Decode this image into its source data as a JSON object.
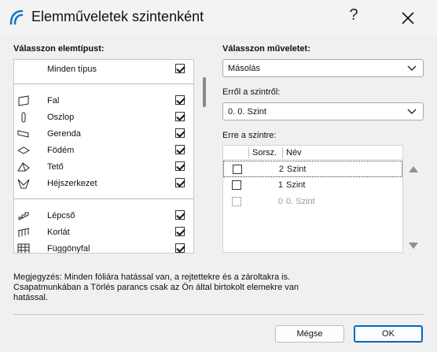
{
  "window": {
    "title": "Elemműveletek szintenként",
    "help_label": "?",
    "accent_color": "#1a73c8"
  },
  "element_types": {
    "label": "Válasszon elemtípust:",
    "all_label": "Minden típus",
    "all_checked": true,
    "groups": [
      [
        {
          "label": "Fal",
          "icon": "wall-icon",
          "checked": true
        },
        {
          "label": "Oszlop",
          "icon": "column-icon",
          "checked": true
        },
        {
          "label": "Gerenda",
          "icon": "beam-icon",
          "checked": true
        },
        {
          "label": "Födém",
          "icon": "slab-icon",
          "checked": true
        },
        {
          "label": "Tető",
          "icon": "roof-icon",
          "checked": true
        },
        {
          "label": "Héjszerkezet",
          "icon": "shell-icon",
          "checked": true
        }
      ],
      [
        {
          "label": "Lépcső",
          "icon": "stair-icon",
          "checked": true
        },
        {
          "label": "Korlát",
          "icon": "railing-icon",
          "checked": true
        },
        {
          "label": "Függönyfal",
          "icon": "curtain-wall-icon",
          "checked": true
        }
      ]
    ]
  },
  "operation": {
    "label": "Válasszon műveletet:",
    "value": "Másolás"
  },
  "from_level": {
    "label": "Erről a szintről:",
    "value": "0. 0. Szint"
  },
  "to_level": {
    "label": "Erre a szintre:",
    "columns": [
      "Sorsz.",
      "Név"
    ],
    "rows": [
      {
        "num": "2",
        "name": "Szint",
        "checked": false,
        "enabled": true,
        "selected": true
      },
      {
        "num": "1",
        "name": "Szint",
        "checked": false,
        "enabled": true,
        "selected": false
      },
      {
        "num": "0",
        "name": "0. Szint",
        "checked": false,
        "enabled": false,
        "selected": false
      }
    ]
  },
  "note": "Megjegyzés: Minden fóliára hatással van, a rejtettekre és a zároltakra is. Csapatmunkában a Törlés parancs csak az Ön által birtokolt elemekre van hatással.",
  "buttons": {
    "cancel": "Mégse",
    "ok": "OK"
  }
}
